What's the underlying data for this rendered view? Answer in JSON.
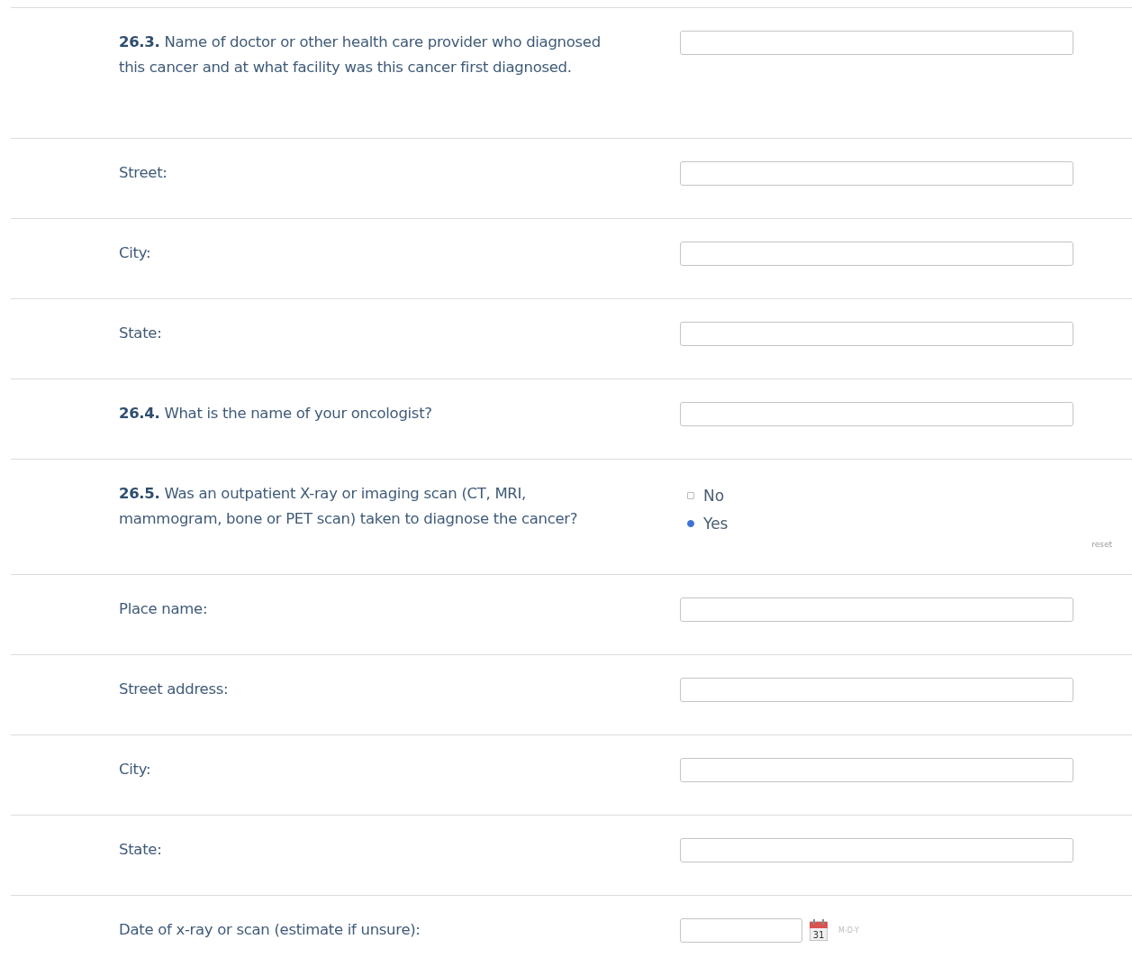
{
  "rows": [
    {
      "kind": "text",
      "number": "26.3.",
      "label": "Name of doctor or other health care provider who diagnosed this cancer and at what facility was this cancer first diagnosed."
    },
    {
      "kind": "text",
      "label": "Street:"
    },
    {
      "kind": "text",
      "label": "City:"
    },
    {
      "kind": "text",
      "label": "State:"
    },
    {
      "kind": "text",
      "number": "26.4.",
      "label": "What is the name of your oncologist?"
    },
    {
      "kind": "radio",
      "number": "26.5.",
      "label": "Was an outpatient X-ray or imaging scan (CT, MRI, mammogram, bone or PET scan) taken to diagnose the cancer?",
      "options": [
        {
          "label": "No",
          "selected": false
        },
        {
          "label": "Yes",
          "selected": true
        }
      ],
      "reset": "reset"
    },
    {
      "kind": "text",
      "label": "Place name:"
    },
    {
      "kind": "text",
      "label": "Street address:"
    },
    {
      "kind": "text",
      "label": "City:"
    },
    {
      "kind": "text",
      "label": "State:"
    },
    {
      "kind": "date",
      "label": "Date of x-ray or scan (estimate if unsure):",
      "hint": "M-D-Y",
      "calendar_day": "31"
    }
  ]
}
